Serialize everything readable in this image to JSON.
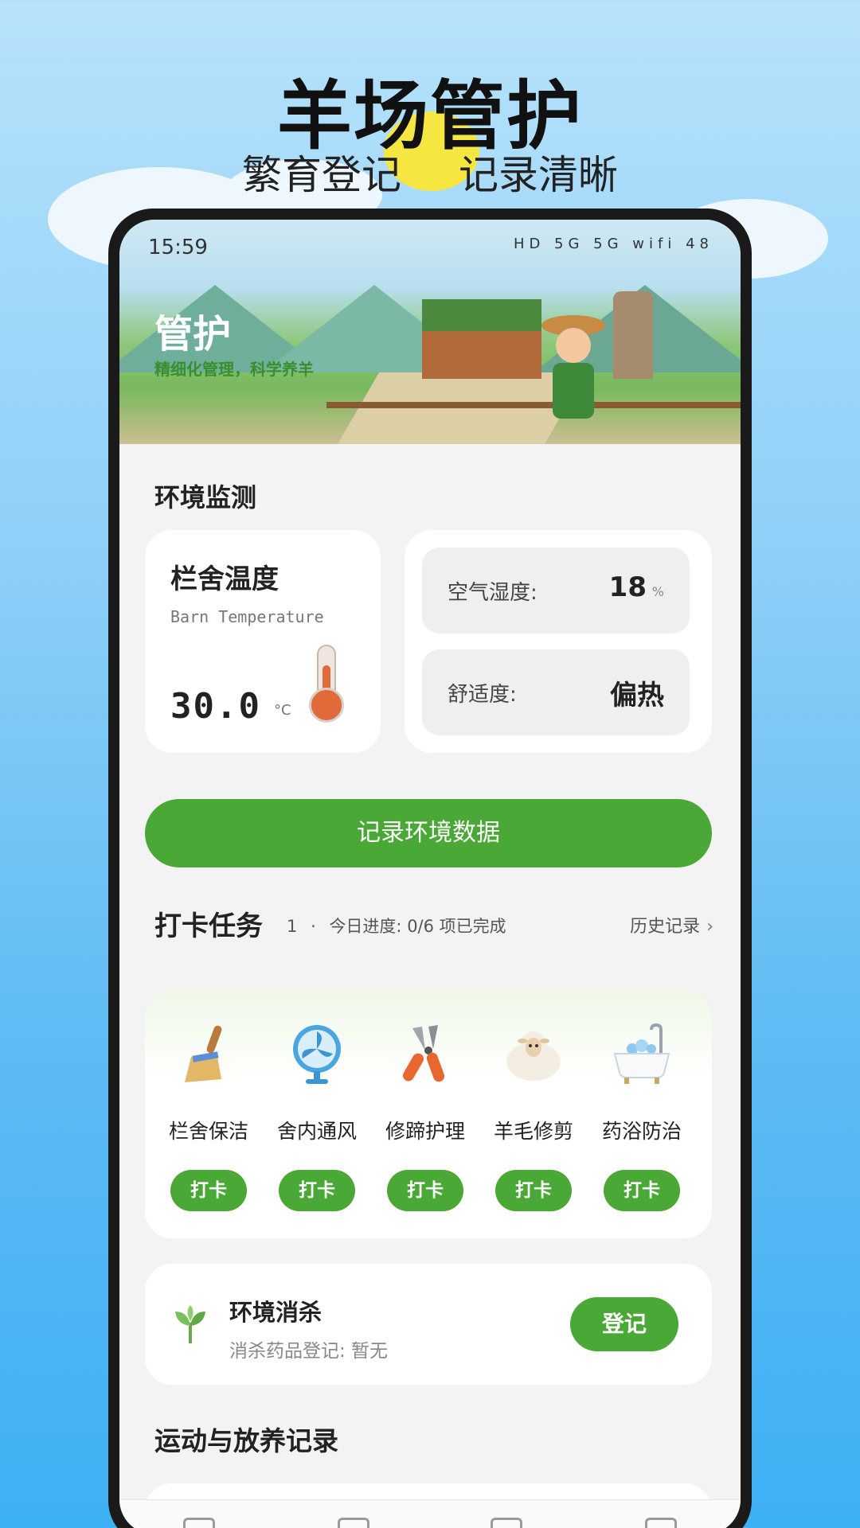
{
  "promo": {
    "title": "羊场管护",
    "subtitle_left": "繁育登记",
    "subtitle_right": "记录清晰"
  },
  "status_bar": {
    "time": "15:59",
    "icons": "HD 5G 5G wifi 48",
    "battery": "48"
  },
  "banner": {
    "title": "管护",
    "subtitle": "精细化管理，科学养羊"
  },
  "environment": {
    "section_title": "环境监测",
    "temperature": {
      "label": "栏舍温度",
      "label_en": "Barn Temperature",
      "value": "30.0",
      "unit": "°C",
      "icon": "thermometer-icon"
    },
    "humidity": {
      "label": "空气湿度:",
      "value": "18",
      "unit": "%"
    },
    "comfort": {
      "label": "舒适度:",
      "value": "偏热"
    },
    "record_button": "记录环境数据"
  },
  "tasks": {
    "section_title": "打卡任务",
    "count": "1",
    "separator": "·",
    "progress_text": "今日进度: 0/6  项已完成",
    "history_label": "历史记录",
    "items": [
      {
        "name": "栏舍保洁",
        "button": "打卡",
        "icon": "broom-icon"
      },
      {
        "name": "舍内通风",
        "button": "打卡",
        "icon": "fan-icon"
      },
      {
        "name": "修蹄护理",
        "button": "打卡",
        "icon": "pliers-icon"
      },
      {
        "name": "羊毛修剪",
        "button": "打卡",
        "icon": "sheep-icon"
      },
      {
        "name": "药浴防治",
        "button": "打卡",
        "icon": "bathtub-icon"
      }
    ]
  },
  "disinfection": {
    "title": "环境消杀",
    "subtitle": "消杀药品登记: 暂无",
    "button": "登记",
    "icon": "leaf-icon"
  },
  "exercise": {
    "section_title": "运动与放养记录"
  },
  "colors": {
    "accent_green": "#4aa836",
    "sky_blue": "#5cbaf3"
  }
}
